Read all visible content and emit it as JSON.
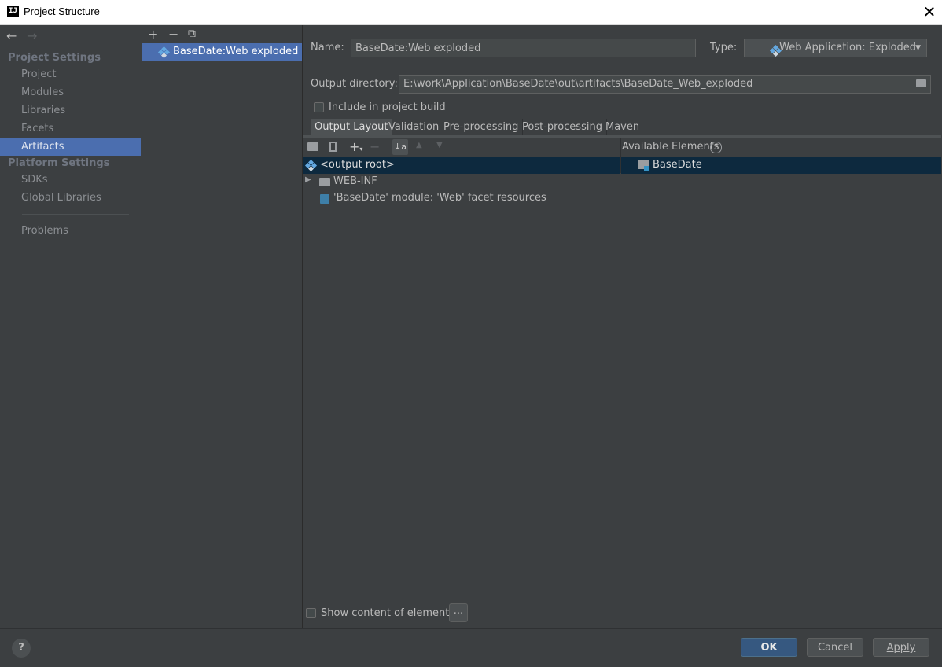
{
  "window": {
    "title": "Project Structure",
    "app_icon": "IJ",
    "close_glyph": "✕"
  },
  "nav": {
    "back": "←",
    "forward": "→",
    "project_settings": "Project Settings",
    "project_items": [
      "Project",
      "Modules",
      "Libraries",
      "Facets",
      "Artifacts"
    ],
    "platform_settings": "Platform Settings",
    "platform_items": [
      "SDKs",
      "Global Libraries"
    ],
    "problems": "Problems",
    "selected": "Artifacts"
  },
  "artifacts": {
    "add": "+",
    "remove": "−",
    "copy": "⧉",
    "items": [
      "BaseDate:Web exploded"
    ]
  },
  "form": {
    "name_label": "Name:",
    "name_value": "BaseDate:Web exploded",
    "type_label": "Type:",
    "type_value": "Web Application: Exploded",
    "output_label": "Output directory:",
    "output_value": "E:\\work\\Application\\BaseDate\\out\\artifacts\\BaseDate_Web_exploded",
    "include_build": "Include in project build",
    "include_checked": false
  },
  "tabs": [
    "Output Layout",
    "Validation",
    "Pre-processing",
    "Post-processing",
    "Maven"
  ],
  "layout": {
    "available_elements": "Available Elements",
    "help_glyph": "?",
    "tree": [
      {
        "label": "<output root>"
      },
      {
        "label": "WEB-INF"
      },
      {
        "label": "'BaseDate' module: 'Web' facet resources"
      }
    ],
    "available": [
      "BaseDate"
    ],
    "show_content": "Show content of elements",
    "show_content_checked": false,
    "ellipsis": "..."
  },
  "footer": {
    "help": "?",
    "ok": "OK",
    "cancel": "Cancel",
    "apply": "Apply"
  },
  "colors": {
    "accent": "#4b6eaf",
    "ok": "#365880",
    "background": "#3c3f41",
    "tree_selection": "#0d293e"
  }
}
